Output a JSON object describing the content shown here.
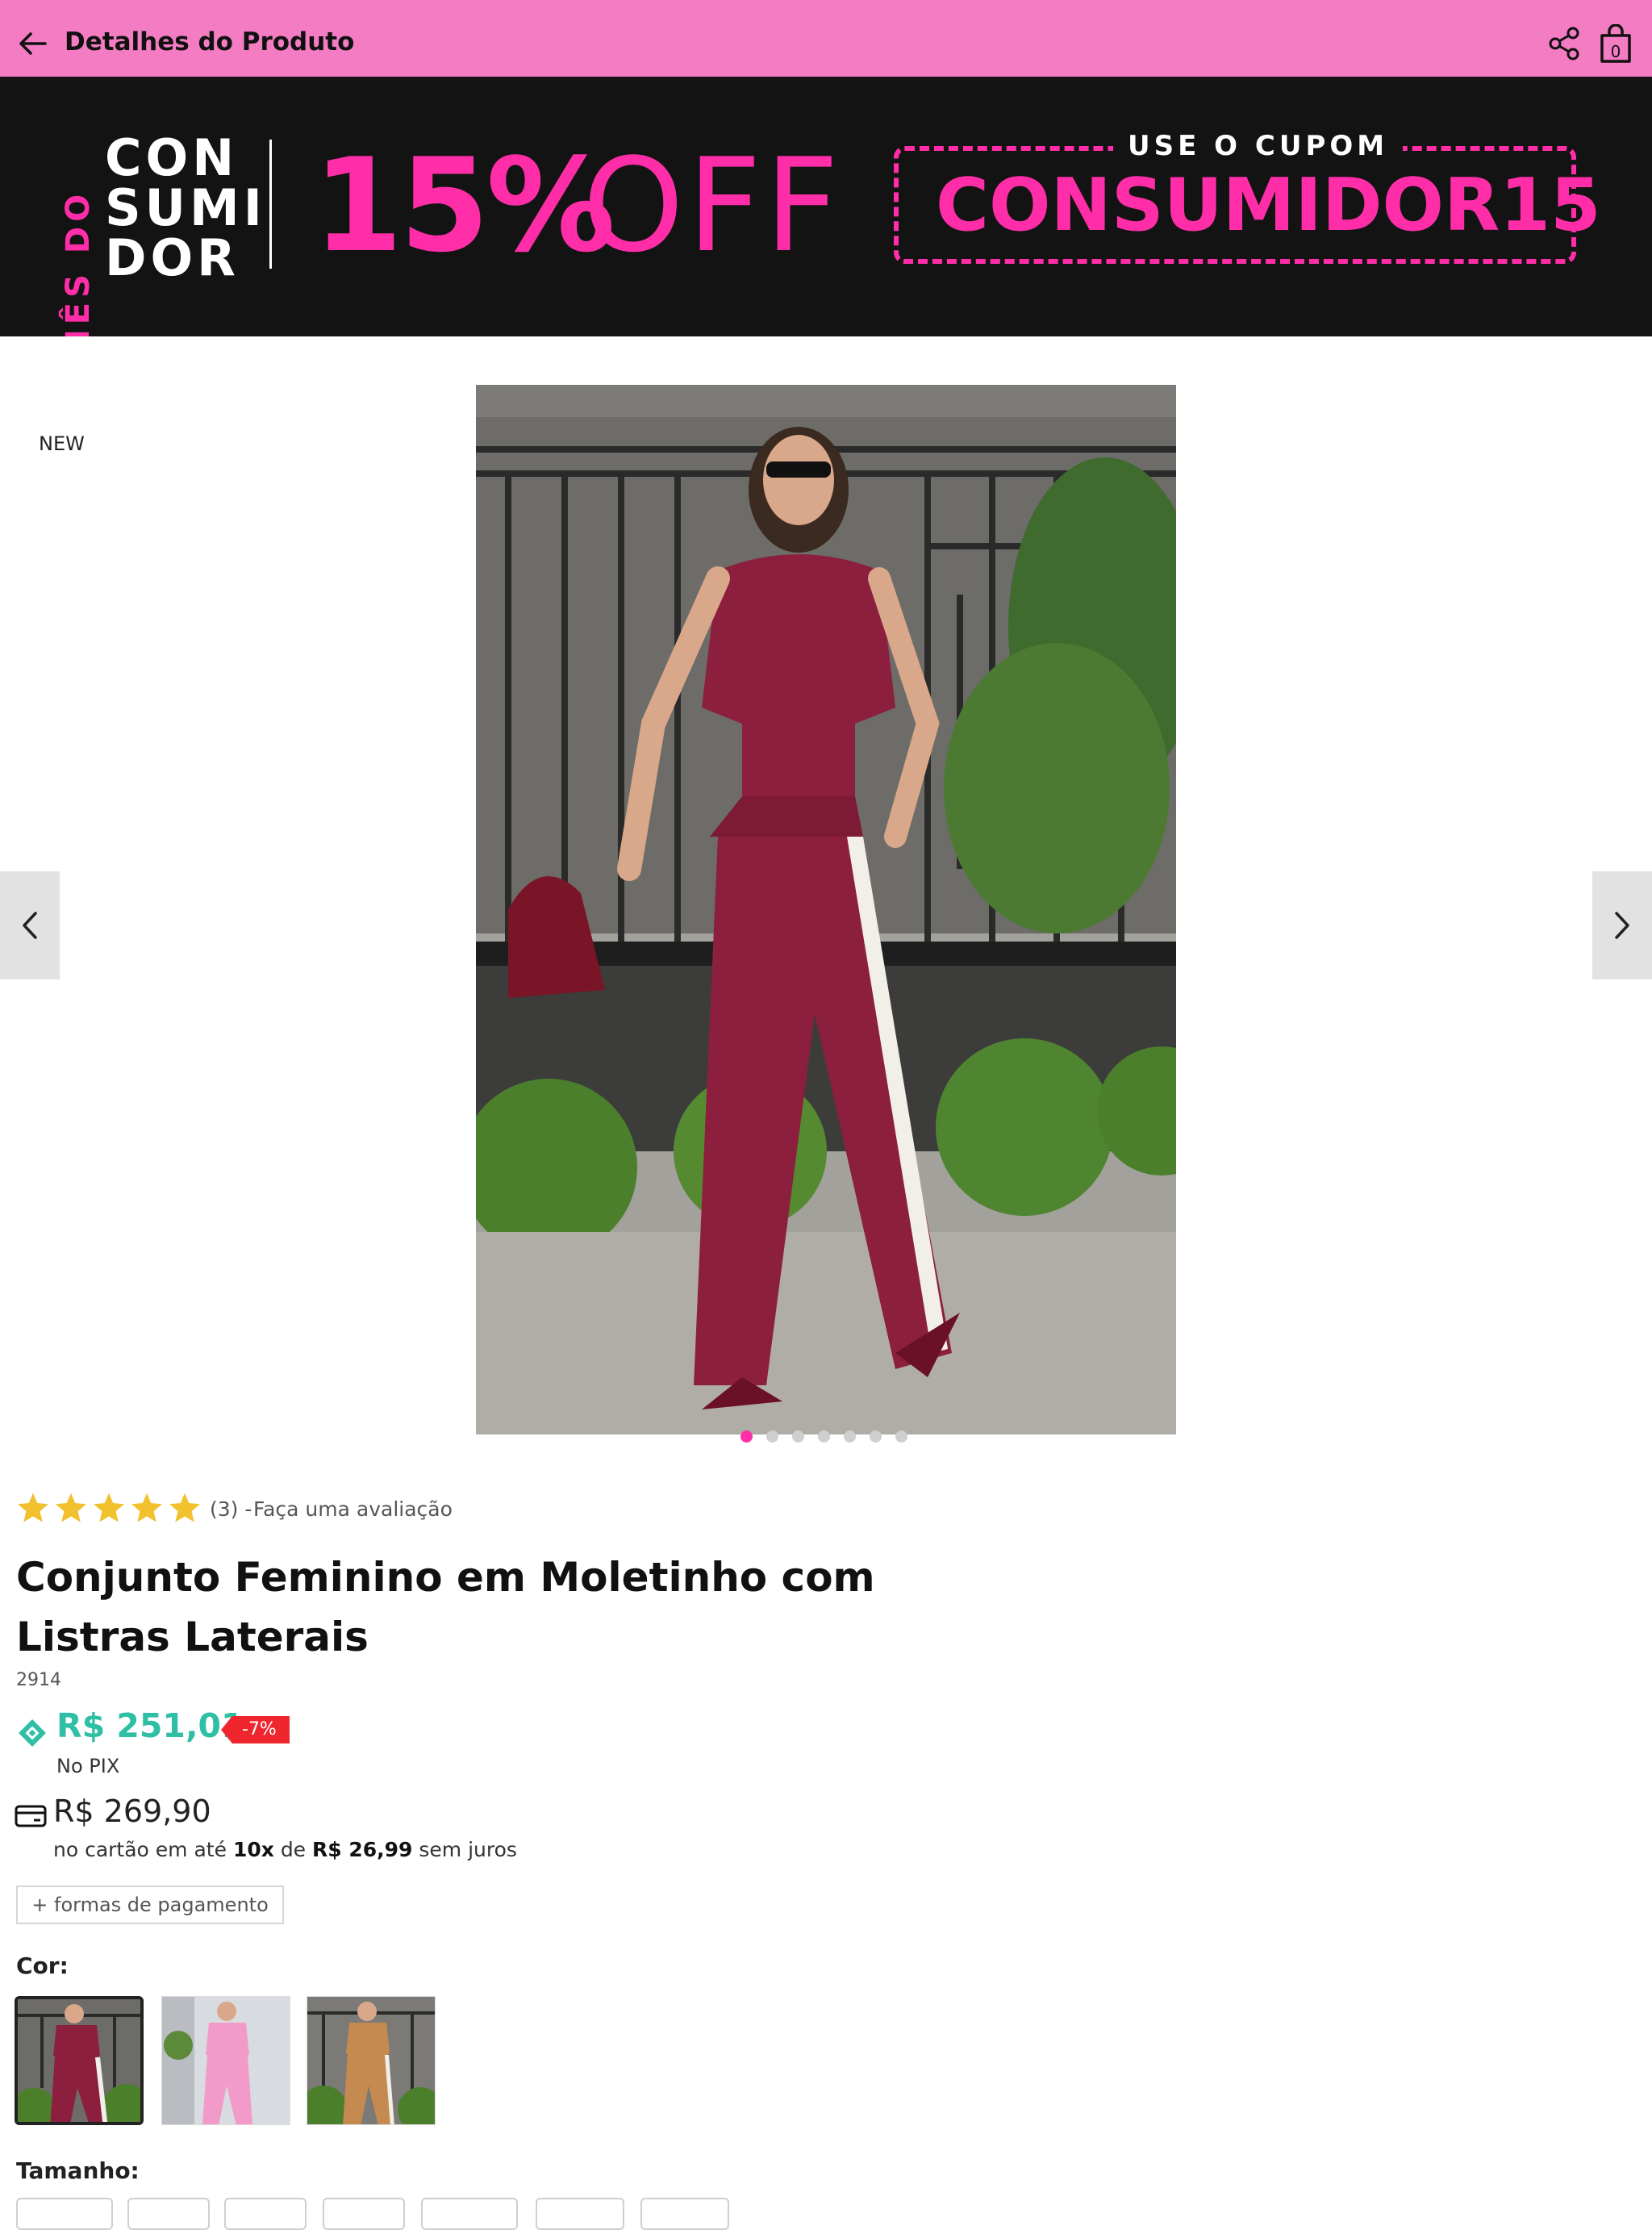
{
  "header": {
    "title": "Detalhes do Produto",
    "back_icon": "arrow-left-icon",
    "share_icon": "share-icon",
    "bag_icon": "shopping-bag-icon",
    "bag_count": "0",
    "background": "#f47cc3"
  },
  "banner": {
    "side_text": "MÊS DO",
    "consumidor_lines": [
      "CON",
      "SUMI",
      "DOR"
    ],
    "percent": "15%",
    "off": "OFF",
    "use_cupom": "USE O CUPOM",
    "coupon_code": "CONSUMIDOR15",
    "accent": "#ff2ea8"
  },
  "gallery": {
    "badge": "NEW",
    "prev_icon": "chevron-left-icon",
    "next_icon": "chevron-right-icon",
    "dot_count": 7,
    "active_dot": 1
  },
  "rating": {
    "stars": 5,
    "count": "(3) -",
    "link": "Faça uma avaliação",
    "star_color": "#f2c12e"
  },
  "product": {
    "title": "Conjunto Feminino em Moletinho com Listras Laterais",
    "sku": "2914"
  },
  "pricing": {
    "pix_icon": "pix-icon",
    "pix_price": "R$ 251,01",
    "discount": "-7%",
    "pix_label": "No PIX",
    "card_icon": "credit-card-icon",
    "card_price": "R$ 269,90",
    "installments_prefix": "no cartão em até",
    "installments_count": "10x",
    "installments_mid": "de",
    "installment_value": "R$ 26,99",
    "installments_suffix": "sem juros",
    "payment_button": "+ formas de pagamento",
    "pix_color": "#2ebfa5"
  },
  "colors": {
    "label": "Cor:",
    "options": [
      "vinho",
      "rosa",
      "caramelo"
    ]
  },
  "sizes": {
    "label": "Tamanho:"
  }
}
